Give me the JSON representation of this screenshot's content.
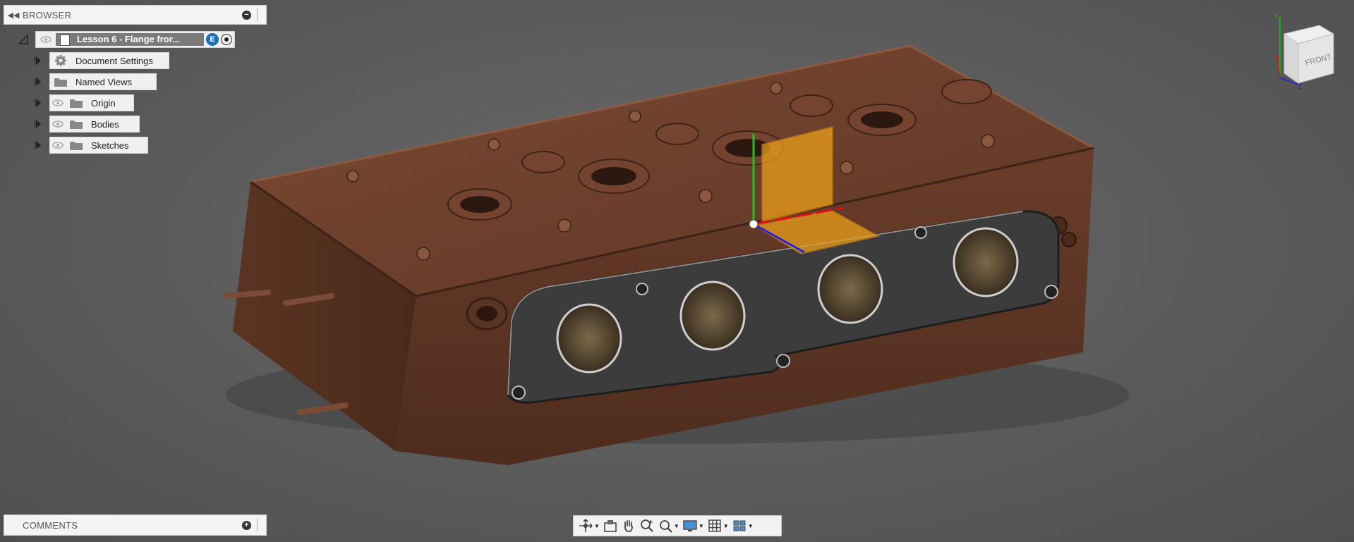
{
  "browser": {
    "title": "BROWSER",
    "collapse_icon": "double-left-arrow-icon",
    "root": {
      "label": "Lesson 6 - Flange fror...",
      "badge": "E"
    },
    "items": [
      {
        "label": "Document Settings",
        "icon": "gear-icon",
        "visible_toggle": false
      },
      {
        "label": "Named Views",
        "icon": "folder-icon",
        "visible_toggle": false
      },
      {
        "label": "Origin",
        "icon": "folder-icon",
        "visible_toggle": true
      },
      {
        "label": "Bodies",
        "icon": "folder-icon",
        "visible_toggle": true
      },
      {
        "label": "Sketches",
        "icon": "folder-icon",
        "visible_toggle": true
      }
    ]
  },
  "comments": {
    "title": "COMMENTS"
  },
  "viewcube": {
    "face_label": "FRONT",
    "axis_y": "Y",
    "axis_z": "Z"
  },
  "toolbar": {
    "tools": [
      "orbit-icon",
      "look-at-icon",
      "pan-icon",
      "zoom-icon",
      "fit-icon",
      "display-settings-icon",
      "grid-icon",
      "viewports-icon"
    ]
  },
  "colors": {
    "background": "#5e5e5e",
    "part": "#6b3f2c",
    "flange": "#3a3a3a",
    "plane": "#f0a21a",
    "x_axis": "#d11",
    "y_axis": "#1c1",
    "z_axis": "#22d",
    "badge": "#1a6fb5"
  }
}
